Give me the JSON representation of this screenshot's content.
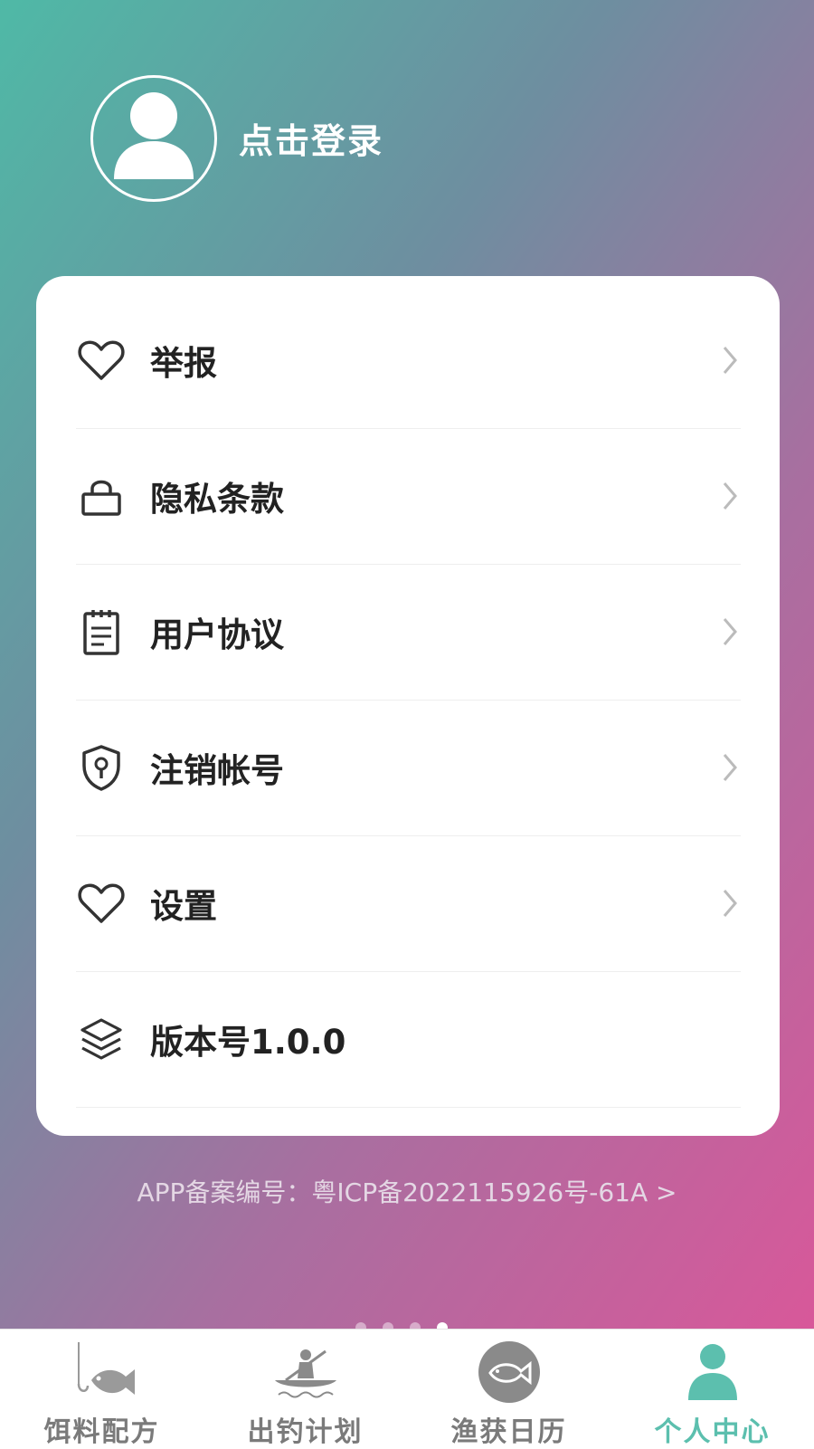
{
  "profile": {
    "login_label": "点击登录"
  },
  "menu": [
    {
      "label": "举报",
      "icon": "heart-icon"
    },
    {
      "label": "隐私条款",
      "icon": "lock-icon"
    },
    {
      "label": "用户协议",
      "icon": "notepad-icon"
    },
    {
      "label": "注销帐号",
      "icon": "shield-icon"
    },
    {
      "label": "设置",
      "icon": "heart-icon"
    },
    {
      "label": "版本号1.0.0",
      "icon": "layers-icon"
    }
  ],
  "icp_text": "APP备案编号：粤ICP备2022115926号-61A >",
  "page_indicator": {
    "count": 4,
    "active": 4
  },
  "tabbar": [
    {
      "label": "饵料配方",
      "icon": "fish-hook-icon",
      "active": false
    },
    {
      "label": "出钓计划",
      "icon": "kayak-icon",
      "active": false
    },
    {
      "label": "渔获日历",
      "icon": "fish-circle-icon",
      "active": false
    },
    {
      "label": "个人中心",
      "icon": "person-icon",
      "active": true
    }
  ],
  "colors": {
    "accent": "#5cbfae",
    "inactive": "#7a7a7a",
    "text": "#222222"
  }
}
